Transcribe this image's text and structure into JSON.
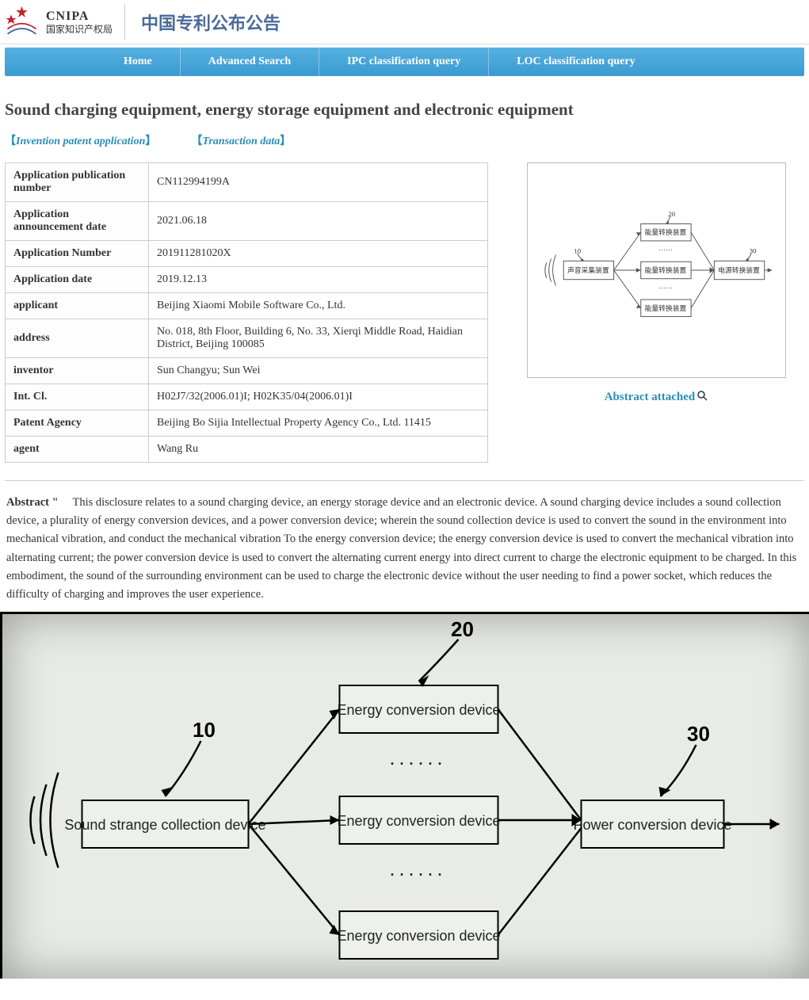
{
  "header": {
    "logo_en": "CNIPA",
    "logo_cn": "国家知识产权局",
    "banner_title": "中国专利公布公告"
  },
  "nav": {
    "home": "Home",
    "advanced": "Advanced Search",
    "ipc": "IPC classification query",
    "loc": "LOC classification query"
  },
  "patent": {
    "title": "Sound charging equipment, energy storage equipment and electronic equipment",
    "meta1": "Invention patent application",
    "meta2": "Transaction data",
    "rows": {
      "pub_num_label": "Application publication number",
      "pub_num_value": "CN112994199A",
      "ann_date_label": "Application announcement date",
      "ann_date_value": "2021.06.18",
      "app_num_label": "Application Number",
      "app_num_value": "201911281020X",
      "app_date_label": "Application date",
      "app_date_value": "2019.12.13",
      "applicant_label": "applicant",
      "applicant_value": "Beijing Xiaomi Mobile Software Co., Ltd.",
      "address_label": "address",
      "address_value": "No. 018, 8th Floor, Building 6, No. 33, Xierqi Middle Road, Haidian District, Beijing 100085",
      "inventor_label": "inventor",
      "inventor_value": "Sun Changyu; Sun Wei",
      "intcl_label": "Int. Cl.",
      "intcl_value": "H02J7/32(2006.01)I; H02K35/04(2006.01)I",
      "agency_label": "Patent Agency",
      "agency_value": "Beijing Bo Sijia Intellectual Property Agency Co., Ltd. 11415",
      "agent_label": "agent",
      "agent_value": "Wang Ru"
    },
    "attached_link": "Abstract attached",
    "abstract_label": "Abstract \"",
    "abstract_body": "This disclosure relates to a sound charging device, an energy storage device and an electronic device. A sound charging device includes a sound collection device, a plurality of energy conversion devices, and a power conversion device; wherein the sound collection device is used to convert the sound in the environment into mechanical vibration, and conduct the mechanical vibration To the energy conversion device; the energy conversion device is used to convert the mechanical vibration into alternating current; the power conversion device is used to convert the alternating current energy into direct current to charge the electronic equipment to be charged. In this embodiment, the sound of the surrounding environment can be used to charge the electronic device without the user needing to find a power socket, which reduces the difficulty of charging and improves the user experience."
  },
  "thumb_diagram": {
    "n10": "10",
    "n20": "20",
    "n30": "30",
    "box_collect": "声音采集装置",
    "box_energy": "能量转换装置",
    "box_power": "电源转换装置",
    "dots": "······"
  },
  "big_diagram": {
    "n10": "10",
    "n20": "20",
    "n30": "30",
    "box_collect": "Sound strange collection device",
    "box_energy": "Energy conversion device",
    "box_power": "Power conversion device",
    "dots": "······"
  }
}
